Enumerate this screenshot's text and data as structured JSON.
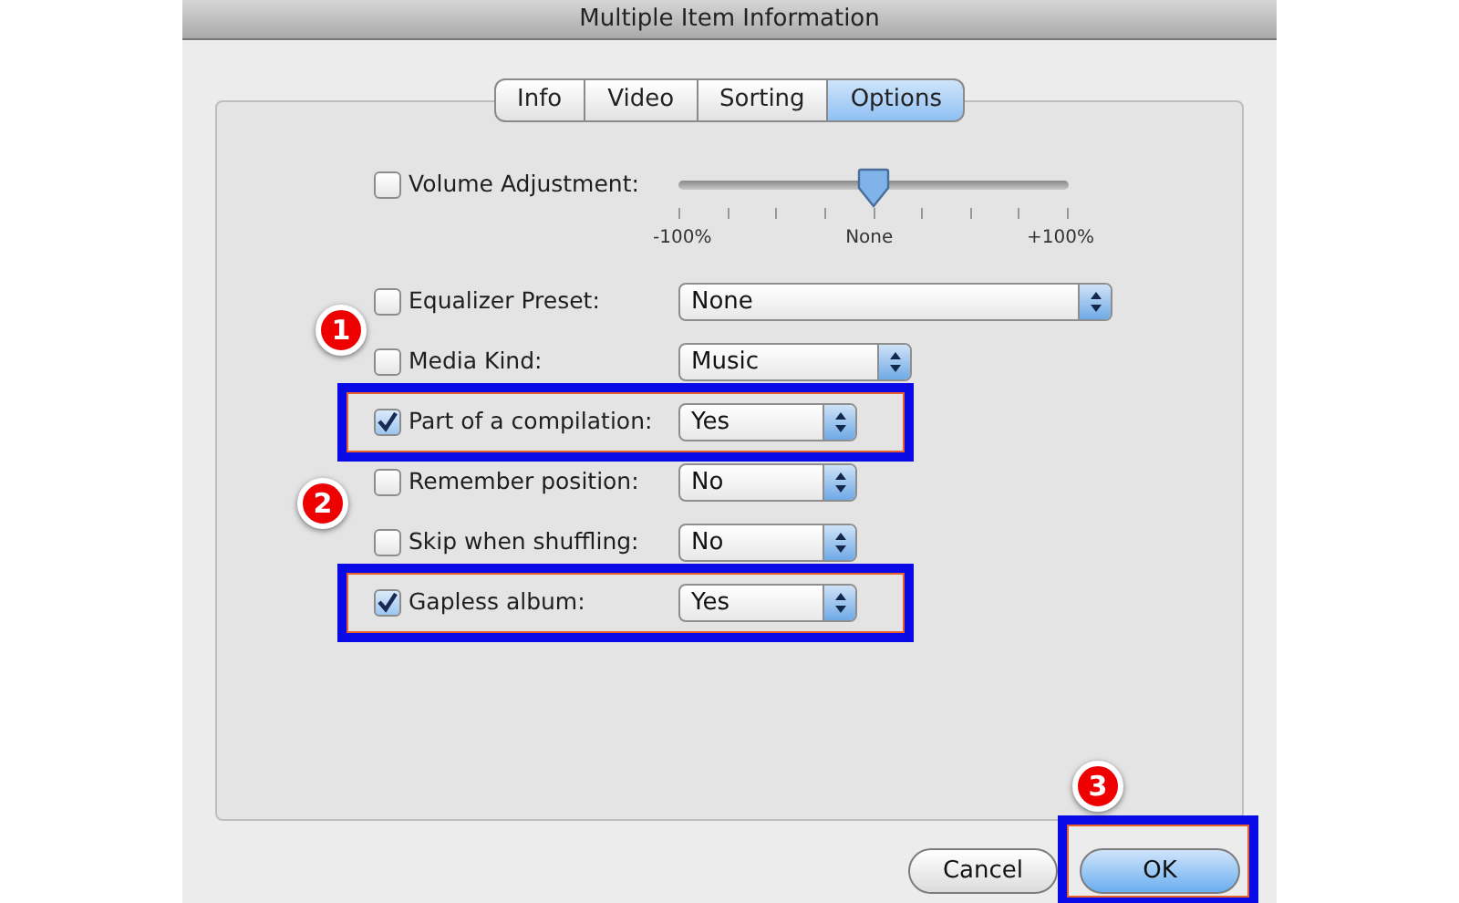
{
  "window": {
    "title": "Multiple Item Information"
  },
  "tabs": [
    {
      "label": "Info",
      "selected": false
    },
    {
      "label": "Video",
      "selected": false
    },
    {
      "label": "Sorting",
      "selected": false
    },
    {
      "label": "Options",
      "selected": true
    }
  ],
  "rows": [
    {
      "kind": "slider",
      "label": "Volume Adjustment:",
      "checked": false,
      "level": 0.5,
      "tick_labels": [
        "-100%",
        "None",
        "+100%"
      ]
    },
    {
      "kind": "popup",
      "label": "Equalizer Preset:",
      "checked": false,
      "value": "None",
      "highlighted": false
    },
    {
      "kind": "popup",
      "label": "Media Kind:",
      "checked": false,
      "value": "Music",
      "highlighted": false
    },
    {
      "kind": "popup",
      "label": "Part of a compilation:",
      "checked": true,
      "value": "Yes",
      "highlighted": true,
      "callout": "1"
    },
    {
      "kind": "popup",
      "label": "Remember position:",
      "checked": false,
      "value": "No",
      "highlighted": false
    },
    {
      "kind": "popup",
      "label": "Skip when shuffling:",
      "checked": false,
      "value": "No",
      "highlighted": false
    },
    {
      "kind": "popup",
      "label": "Gapless album:",
      "checked": true,
      "value": "Yes",
      "highlighted": true,
      "callout": "2"
    }
  ],
  "buttons": [
    {
      "label": "Cancel",
      "default": false,
      "highlighted": false
    },
    {
      "label": "OK",
      "default": true,
      "highlighted": true,
      "callout": "3"
    }
  ]
}
